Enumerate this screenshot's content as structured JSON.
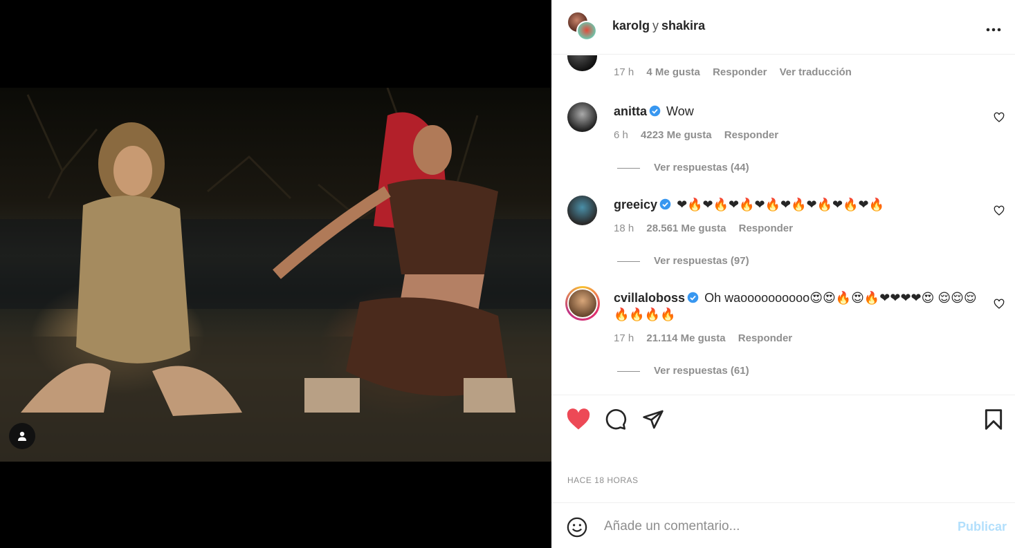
{
  "post": {
    "author_primary": "karolg",
    "conjunction": "y",
    "author_secondary": "shakira",
    "more_icon": "more-horizontal-icon"
  },
  "comments": [
    {
      "user": "",
      "text": "",
      "time": "17 h",
      "likes": "4 Me gusta",
      "reply": "Responder",
      "translate": "Ver traducción"
    },
    {
      "user": "anitta",
      "verified": true,
      "text": "Wow",
      "time": "6 h",
      "likes": "4223 Me gusta",
      "reply": "Responder",
      "view_replies": "Ver respuestas (44)"
    },
    {
      "user": "greeicy",
      "verified": true,
      "text": "❤🔥❤🔥❤🔥❤🔥❤🔥❤🔥❤🔥❤🔥",
      "time": "18 h",
      "likes": "28.561 Me gusta",
      "reply": "Responder",
      "view_replies": "Ver respuestas (97)"
    },
    {
      "user": "cvillaloboss",
      "verified": true,
      "text": "Oh waoooooooooo😍😍🔥😍🔥❤❤❤❤😍 😌😌😌🔥🔥🔥🔥",
      "time": "17 h",
      "likes": "21.114 Me gusta",
      "reply": "Responder",
      "view_replies": "Ver respuestas (61)"
    }
  ],
  "actions": {
    "liked": true,
    "like_color": "#ed4956",
    "verified_color": "#3897f0"
  },
  "timestamp": "HACE 18 HORAS",
  "composer": {
    "placeholder": "Añade un comentario...",
    "publish_label": "Publicar",
    "publish_color": "#b2dffc"
  }
}
